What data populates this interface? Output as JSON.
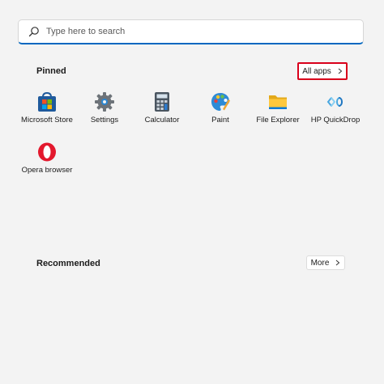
{
  "search": {
    "placeholder": "Type here to search"
  },
  "pinned": {
    "title": "Pinned",
    "all_apps_label": "All apps",
    "apps": [
      {
        "label": "Microsoft Store",
        "icon": "microsoft-store-icon"
      },
      {
        "label": "Settings",
        "icon": "settings-gear-icon"
      },
      {
        "label": "Calculator",
        "icon": "calculator-icon"
      },
      {
        "label": "Paint",
        "icon": "paint-palette-icon"
      },
      {
        "label": "File Explorer",
        "icon": "folder-icon"
      },
      {
        "label": "HP QuickDrop",
        "icon": "hp-quickdrop-icon"
      },
      {
        "label": "Opera browser",
        "icon": "opera-icon"
      }
    ]
  },
  "recommended": {
    "title": "Recommended",
    "more_label": "More"
  },
  "colors": {
    "accent": "#0067c0",
    "highlight": "#d9001b",
    "background": "#f3f3f3"
  }
}
